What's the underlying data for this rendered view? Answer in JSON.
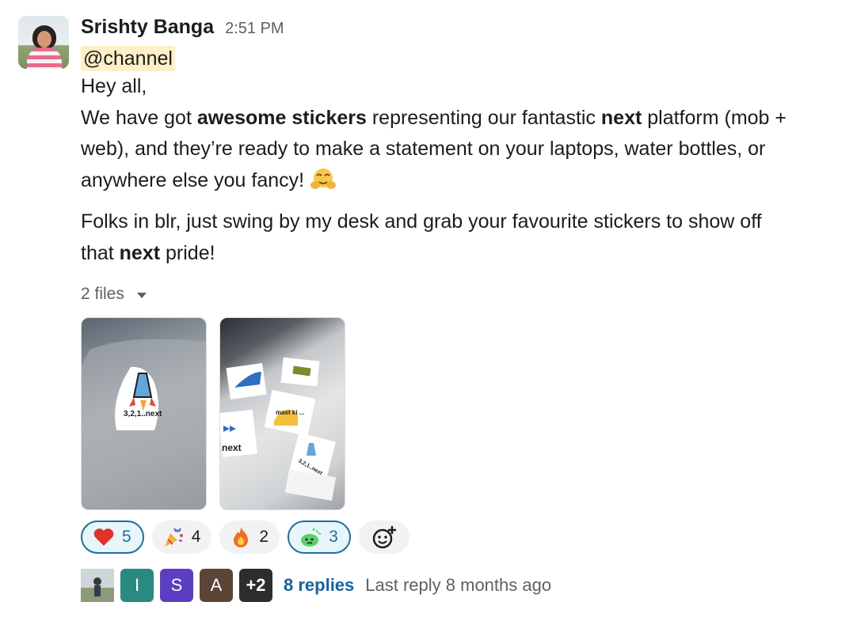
{
  "message": {
    "author": "Srishty Banga",
    "time": "2:51 PM",
    "mention": "@channel",
    "line1": "Hey all,",
    "p1": [
      {
        "text": "We have got ",
        "bold": false
      },
      {
        "text": "awesome stickers",
        "bold": true
      },
      {
        "text": " representing our fantastic ",
        "bold": false
      },
      {
        "text": "next",
        "bold": true
      },
      {
        "text": " platform (mob +",
        "bold": false
      }
    ],
    "p1_line2": "web), and they’re ready to make a statement on your laptops, water bottles, or",
    "p1_line3": "anywhere else you fancy! ",
    "p2_line1": "Folks in blr, just swing by my desk and grab your favourite stickers to show off",
    "p2_line2_pre": "that ",
    "p2_line2_bold": "next",
    "p2_line2_post": " pride!"
  },
  "files": {
    "label": "2 files"
  },
  "stickers": {
    "s1": "3,2,1..next",
    "s2": "next",
    "s3": "mast ki ...",
    "s4": "3,2,1..next"
  },
  "reactions": [
    {
      "emoji": "heart",
      "count": "5",
      "mine": true
    },
    {
      "emoji": "party-popper",
      "count": "4",
      "mine": false
    },
    {
      "emoji": "fire",
      "count": "2",
      "mine": false
    },
    {
      "emoji": "green-blob",
      "count": "3",
      "mine": true
    }
  ],
  "thread": {
    "avatars": [
      {
        "label": "",
        "color": "#6b6f73"
      },
      {
        "label": "I",
        "color": "#2b8a7e"
      },
      {
        "label": "S",
        "color": "#5b3ec2"
      },
      {
        "label": "A",
        "color": "#5c4536"
      },
      {
        "label": "+2",
        "color": "#2d2d2d"
      }
    ],
    "replies": "8 replies",
    "last_reply": "Last reply 8 months ago"
  },
  "colors": {
    "accent": "#1264a3",
    "mention_bg": "#fdf0c6",
    "reaction_bg": "#f2f2f2",
    "reaction_mine_border": "#1d6fa3"
  }
}
